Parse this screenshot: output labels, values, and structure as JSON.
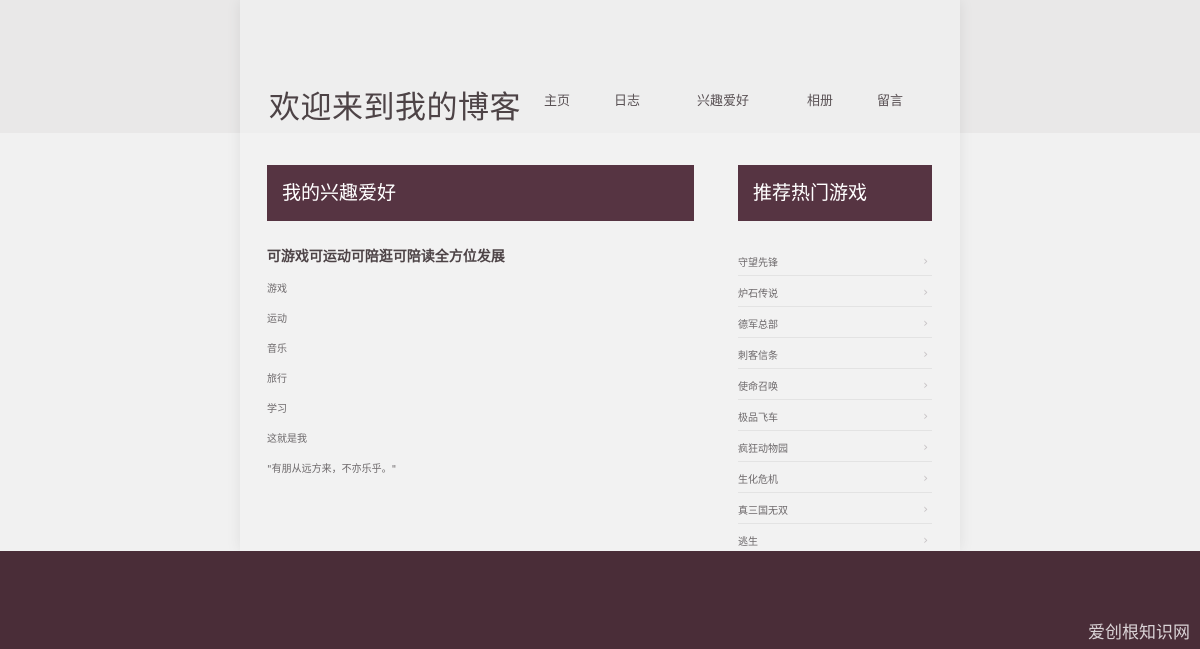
{
  "header": {
    "site_title": "欢迎来到我的博客",
    "nav": [
      "主页",
      "日志",
      "兴趣爱好",
      "相册",
      "留言"
    ]
  },
  "main": {
    "panel_title": "我的兴趣爱好",
    "subtitle": "可游戏可运动可陪逛可陪读全方位发展",
    "items": [
      "游戏",
      "运动",
      "音乐",
      "旅行",
      "学习",
      "这就是我",
      "\"有朋从远方来，不亦乐乎。\""
    ]
  },
  "sidebar": {
    "panel_title": "推荐热门游戏",
    "games": [
      "守望先锋",
      "炉石传说",
      "德军总部",
      "刺客信条",
      "使命召唤",
      "极品飞车",
      "疯狂动物园",
      "生化危机",
      "真三国无双",
      "逃生"
    ]
  },
  "watermark": "爱创根知识网",
  "colors": {
    "accent": "#563442",
    "footer": "#4a2d38",
    "background": "#f0f0f0"
  }
}
